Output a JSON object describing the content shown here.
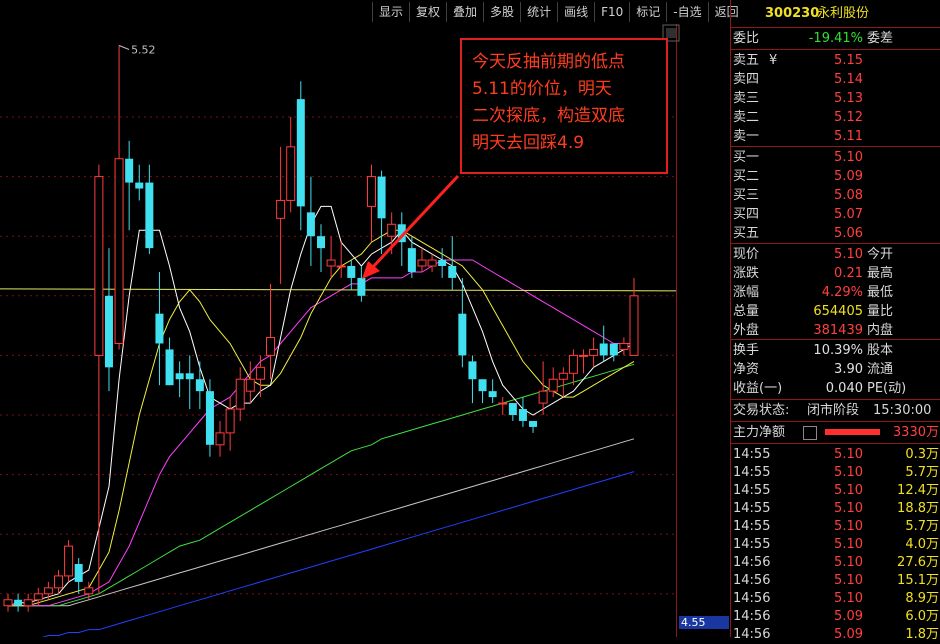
{
  "toolbar": [
    "显示",
    "复权",
    "叠加",
    "多股",
    "统计",
    "画线",
    "F10",
    "标记",
    "-自选",
    "返回"
  ],
  "chart": {
    "y_ticks": [
      "5.40",
      "5.30",
      "5.20",
      "5.10",
      "5.00",
      "4.90",
      "4.80",
      "4.70",
      "4.60"
    ],
    "high_label": "5.52",
    "current_price_tag": "4.55",
    "annotation_lines": [
      "今天反抽前期的低点",
      "5.11的价位，明天",
      "二次探底，构造双底",
      "明天去回踩4.9"
    ]
  },
  "colors": {
    "up": "#ff3c3c",
    "down": "#40e0f0",
    "ma5": "#ffffff",
    "ma10": "#f0f040",
    "ma20": "#ff40ff",
    "ma60": "#40e040",
    "ma120": "#c8c8c8",
    "ma250": "#2040ff",
    "hline": "#e8e860"
  },
  "chart_data": {
    "type": "candlestick",
    "ylim": [
      4.55,
      5.62
    ],
    "candles": [
      [
        4.58,
        4.59,
        4.57,
        4.6
      ],
      [
        4.59,
        4.58,
        4.57,
        4.6
      ],
      [
        4.58,
        4.59,
        4.57,
        4.6
      ],
      [
        4.59,
        4.6,
        4.58,
        4.61
      ],
      [
        4.6,
        4.61,
        4.59,
        4.62
      ],
      [
        4.61,
        4.63,
        4.6,
        4.64
      ],
      [
        4.63,
        4.68,
        4.62,
        4.69
      ],
      [
        4.65,
        4.62,
        4.6,
        4.66
      ],
      [
        4.6,
        4.61,
        4.59,
        4.62
      ],
      [
        5.0,
        5.3,
        4.6,
        5.32
      ],
      [
        5.1,
        4.98,
        4.94,
        5.18
      ],
      [
        5.02,
        5.33,
        5.01,
        5.52
      ],
      [
        5.33,
        5.29,
        5.21,
        5.36
      ],
      [
        5.29,
        5.28,
        5.26,
        5.32
      ],
      [
        5.29,
        5.18,
        5.17,
        5.32
      ],
      [
        5.07,
        5.02,
        4.95,
        5.14
      ],
      [
        5.01,
        4.95,
        4.95,
        5.03
      ],
      [
        4.97,
        4.96,
        4.93,
        4.99
      ],
      [
        4.97,
        4.96,
        4.91,
        5.0
      ],
      [
        4.96,
        4.94,
        4.91,
        4.99
      ],
      [
        4.94,
        4.85,
        4.83,
        4.96
      ],
      [
        4.85,
        4.87,
        4.83,
        4.89
      ],
      [
        4.87,
        4.91,
        4.84,
        4.93
      ],
      [
        4.91,
        4.96,
        4.89,
        4.98
      ],
      [
        4.94,
        4.96,
        4.92,
        4.99
      ],
      [
        4.96,
        4.98,
        4.93,
        5.0
      ],
      [
        5.0,
        5.03,
        4.96,
        5.12
      ],
      [
        5.23,
        5.26,
        5.12,
        5.35
      ],
      [
        5.26,
        5.35,
        5.24,
        5.4
      ],
      [
        5.43,
        5.25,
        5.21,
        5.46
      ],
      [
        5.24,
        5.2,
        5.15,
        5.3
      ],
      [
        5.2,
        5.18,
        5.14,
        5.22
      ],
      [
        5.15,
        5.16,
        5.13,
        5.2
      ],
      [
        5.15,
        5.15,
        5.13,
        5.19
      ],
      [
        5.15,
        5.13,
        5.11,
        5.16
      ],
      [
        5.13,
        5.1,
        5.09,
        5.15
      ],
      [
        5.25,
        5.3,
        5.19,
        5.32
      ],
      [
        5.3,
        5.23,
        5.17,
        5.31
      ],
      [
        5.2,
        5.22,
        5.17,
        5.24
      ],
      [
        5.22,
        5.19,
        5.15,
        5.24
      ],
      [
        5.18,
        5.14,
        5.13,
        5.2
      ],
      [
        5.15,
        5.16,
        5.14,
        5.18
      ],
      [
        5.15,
        5.16,
        5.14,
        5.17
      ],
      [
        5.16,
        5.15,
        5.13,
        5.18
      ],
      [
        5.15,
        5.13,
        5.11,
        5.2
      ],
      [
        5.07,
        5.0,
        4.98,
        5.13
      ],
      [
        4.99,
        4.96,
        4.92,
        5.0
      ],
      [
        4.96,
        4.94,
        4.92,
        4.96
      ],
      [
        4.94,
        4.93,
        4.92,
        4.96
      ],
      [
        4.92,
        4.92,
        4.9,
        4.93
      ],
      [
        4.92,
        4.9,
        4.89,
        4.92
      ],
      [
        4.91,
        4.89,
        4.88,
        4.93
      ],
      [
        4.89,
        4.88,
        4.87,
        4.89
      ],
      [
        4.92,
        4.94,
        4.9,
        4.99
      ],
      [
        4.94,
        4.96,
        4.93,
        4.98
      ],
      [
        4.96,
        4.97,
        4.93,
        4.98
      ],
      [
        4.97,
        5.0,
        4.95,
        5.01
      ],
      [
        5.0,
        5.0,
        4.97,
        5.01
      ],
      [
        5.0,
        5.01,
        4.98,
        5.03
      ],
      [
        5.02,
        5.0,
        4.99,
        5.05
      ],
      [
        5.02,
        5.0,
        4.99,
        5.02
      ],
      [
        5.01,
        5.02,
        5.0,
        5.03
      ],
      [
        5.0,
        5.1,
        5.0,
        5.13
      ]
    ],
    "ma5": [
      4.58,
      4.585,
      4.585,
      4.59,
      4.595,
      4.6,
      4.62,
      4.63,
      4.64,
      4.71,
      4.78,
      4.96,
      5.1,
      5.21,
      5.21,
      5.21,
      5.15,
      5.08,
      5.04,
      4.98,
      4.93,
      4.92,
      4.91,
      4.92,
      4.92,
      4.94,
      4.95,
      5.03,
      5.11,
      5.17,
      5.22,
      5.25,
      5.25,
      5.19,
      5.17,
      5.15,
      5.17,
      5.18,
      5.19,
      5.21,
      5.19,
      5.18,
      5.17,
      5.16,
      5.15,
      5.12,
      5.08,
      5.04,
      4.99,
      4.95,
      4.93,
      4.91,
      4.9,
      4.91,
      4.92,
      4.93,
      4.94,
      4.96,
      4.98,
      4.99,
      5.0,
      5.01,
      5.02
    ],
    "ma10": [
      4.58,
      4.58,
      4.58,
      4.585,
      4.59,
      4.595,
      4.6,
      4.605,
      4.61,
      4.64,
      4.67,
      4.74,
      4.82,
      4.9,
      4.96,
      5.02,
      5.06,
      5.09,
      5.11,
      5.09,
      5.06,
      5.04,
      5.02,
      4.99,
      4.96,
      4.95,
      4.95,
      4.97,
      5.0,
      5.03,
      5.07,
      5.1,
      5.13,
      5.15,
      5.16,
      5.17,
      5.19,
      5.2,
      5.21,
      5.21,
      5.2,
      5.19,
      5.18,
      5.17,
      5.16,
      5.15,
      5.13,
      5.11,
      5.08,
      5.05,
      5.02,
      4.99,
      4.97,
      4.95,
      4.94,
      4.93,
      4.93,
      4.94,
      4.95,
      4.96,
      4.97,
      4.98,
      4.99
    ],
    "ma20": [
      4.58,
      4.58,
      4.58,
      4.58,
      4.58,
      4.585,
      4.59,
      4.595,
      4.6,
      4.61,
      4.62,
      4.65,
      4.68,
      4.72,
      4.76,
      4.8,
      4.83,
      4.85,
      4.87,
      4.89,
      4.91,
      4.92,
      4.93,
      4.95,
      4.97,
      4.99,
      5.0,
      5.02,
      5.04,
      5.06,
      5.08,
      5.09,
      5.1,
      5.11,
      5.12,
      5.12,
      5.13,
      5.13,
      5.13,
      5.13,
      5.14,
      5.14,
      5.15,
      5.16,
      5.16,
      5.16,
      5.16,
      5.15,
      5.14,
      5.13,
      5.12,
      5.11,
      5.1,
      5.09,
      5.08,
      5.07,
      5.06,
      5.05,
      5.04,
      5.03,
      5.02,
      5.02,
      5.02
    ],
    "ma60": [
      4.58,
      4.58,
      4.58,
      4.58,
      4.58,
      4.58,
      4.585,
      4.59,
      4.595,
      4.6,
      4.61,
      4.62,
      4.63,
      4.64,
      4.65,
      4.66,
      4.67,
      4.68,
      4.685,
      4.69,
      4.7,
      4.71,
      4.72,
      4.73,
      4.74,
      4.75,
      4.76,
      4.77,
      4.78,
      4.79,
      4.8,
      4.81,
      4.82,
      4.83,
      4.84,
      4.845,
      4.85,
      4.86,
      4.865,
      4.87,
      4.875,
      4.88,
      4.885,
      4.89,
      4.895,
      4.9,
      4.905,
      4.91,
      4.915,
      4.92,
      4.925,
      4.93,
      4.935,
      4.94,
      4.945,
      4.95,
      4.955,
      4.96,
      4.965,
      4.97,
      4.975,
      4.98,
      4.985
    ],
    "ma120": [
      4.58,
      4.58,
      4.58,
      4.58,
      4.58,
      4.58,
      4.58,
      4.585,
      4.59,
      4.595,
      4.6,
      4.605,
      4.61,
      4.615,
      4.62,
      4.625,
      4.63,
      4.635,
      4.64,
      4.645,
      4.65,
      4.655,
      4.66,
      4.665,
      4.67,
      4.675,
      4.68,
      4.685,
      4.69,
      4.695,
      4.7,
      4.705,
      4.71,
      4.715,
      4.72,
      4.725,
      4.73,
      4.735,
      4.74,
      4.745,
      4.75,
      4.755,
      4.76,
      4.765,
      4.77,
      4.775,
      4.78,
      4.785,
      4.79,
      4.795,
      4.8,
      4.805,
      4.81,
      4.815,
      4.82,
      4.825,
      4.83,
      4.835,
      4.84,
      4.845,
      4.85,
      4.855,
      4.86
    ],
    "ma250": [
      4.52,
      4.52,
      4.525,
      4.525,
      4.53,
      4.53,
      4.535,
      4.535,
      4.54,
      4.54,
      4.545,
      4.55,
      4.555,
      4.56,
      4.565,
      4.57,
      4.575,
      4.58,
      4.585,
      4.59,
      4.595,
      4.6,
      4.605,
      4.61,
      4.615,
      4.62,
      4.625,
      4.63,
      4.635,
      4.64,
      4.645,
      4.65,
      4.655,
      4.66,
      4.665,
      4.67,
      4.675,
      4.68,
      4.685,
      4.69,
      4.695,
      4.7,
      4.705,
      4.71,
      4.715,
      4.72,
      4.725,
      4.73,
      4.735,
      4.74,
      4.745,
      4.75,
      4.755,
      4.76,
      4.765,
      4.77,
      4.775,
      4.78,
      4.785,
      4.79,
      4.795,
      4.8,
      4.805
    ],
    "hline": 5.11
  },
  "quote": {
    "code": "300230",
    "name": "永利股份",
    "wb_label": "委比",
    "wb_value": "-19.41%",
    "wc_label": "委差",
    "sells": [
      {
        "label": "卖五",
        "mark": "¥",
        "price": "5.15"
      },
      {
        "label": "卖四",
        "mark": "",
        "price": "5.14"
      },
      {
        "label": "卖三",
        "mark": "",
        "price": "5.13"
      },
      {
        "label": "卖二",
        "mark": "",
        "price": "5.12"
      },
      {
        "label": "卖一",
        "mark": "",
        "price": "5.11"
      }
    ],
    "buys": [
      {
        "label": "买一",
        "price": "5.10"
      },
      {
        "label": "买二",
        "price": "5.09"
      },
      {
        "label": "买三",
        "price": "5.08"
      },
      {
        "label": "买四",
        "price": "5.07"
      },
      {
        "label": "买五",
        "price": "5.06"
      }
    ],
    "stats1": [
      {
        "l": "现价",
        "v": "5.10",
        "r": "今开",
        "c": "red"
      },
      {
        "l": "涨跌",
        "v": "0.21",
        "r": "最高",
        "c": "red"
      },
      {
        "l": "涨幅",
        "v": "4.29%",
        "r": "最低",
        "c": "red"
      },
      {
        "l": "总量",
        "v": "654405",
        "r": "量比",
        "c": "yellow"
      },
      {
        "l": "外盘",
        "v": "381439",
        "r": "内盘",
        "c": "red"
      }
    ],
    "stats2": [
      {
        "l": "换手",
        "v": "10.39%",
        "r": "股本",
        "c": "white"
      },
      {
        "l": "净资",
        "v": "3.90",
        "r": "流通",
        "c": "white"
      },
      {
        "l": "收益(一)",
        "v": "0.040",
        "r": "PE(动)",
        "c": "white"
      }
    ],
    "status_label": "交易状态:",
    "status_value": "闭市阶段",
    "status_time": "15:30:00",
    "main_label": "主力净额",
    "main_value": "3330万",
    "ticks": [
      {
        "t": "14:55",
        "p": "5.10",
        "v": "0.3万"
      },
      {
        "t": "14:55",
        "p": "5.10",
        "v": "5.7万"
      },
      {
        "t": "14:55",
        "p": "5.10",
        "v": "12.4万"
      },
      {
        "t": "14:55",
        "p": "5.10",
        "v": "18.8万"
      },
      {
        "t": "14:55",
        "p": "5.10",
        "v": "5.7万"
      },
      {
        "t": "14:55",
        "p": "5.10",
        "v": "4.0万"
      },
      {
        "t": "14:56",
        "p": "5.10",
        "v": "27.6万"
      },
      {
        "t": "14:56",
        "p": "5.10",
        "v": "15.1万"
      },
      {
        "t": "14:56",
        "p": "5.10",
        "v": "8.9万"
      },
      {
        "t": "14:56",
        "p": "5.09",
        "v": "6.0万"
      },
      {
        "t": "14:56",
        "p": "5.09",
        "v": "1.8万"
      }
    ]
  }
}
